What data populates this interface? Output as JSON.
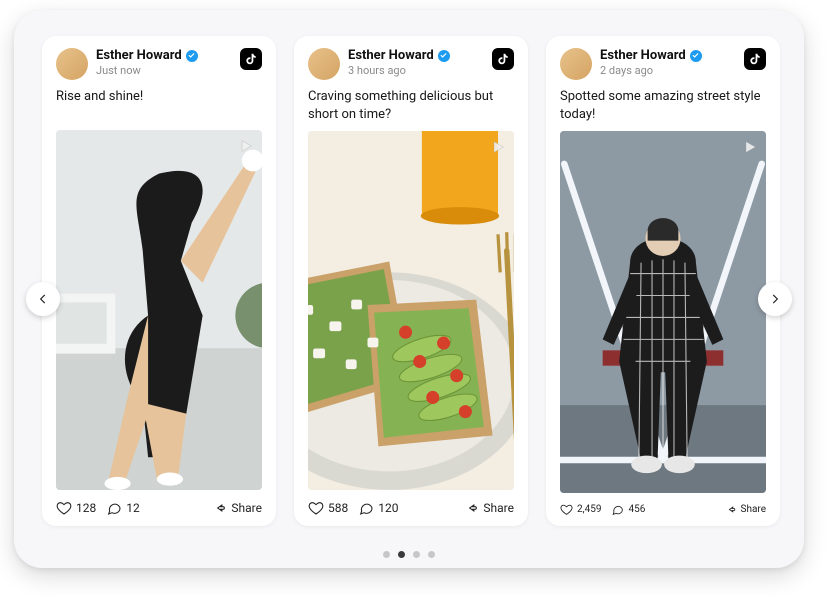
{
  "carousel": {
    "active_index": 1,
    "dot_count": 4
  },
  "posts": [
    {
      "author": "Esther Howard",
      "time": "Just now",
      "platform": "tiktok",
      "caption": "Rise and shine!",
      "likes": "128",
      "comments": "12",
      "share_label": "Share"
    },
    {
      "author": "Esther Howard",
      "time": "3 hours ago",
      "platform": "tiktok",
      "caption": "Craving something delicious but short on time?",
      "likes": "588",
      "comments": "120",
      "share_label": "Share"
    },
    {
      "author": "Esther Howard",
      "time": "2 days ago",
      "platform": "tiktok",
      "caption": "Spotted some amazing street style today!",
      "likes": "2,459",
      "comments": "456",
      "share_label": "Share"
    }
  ]
}
